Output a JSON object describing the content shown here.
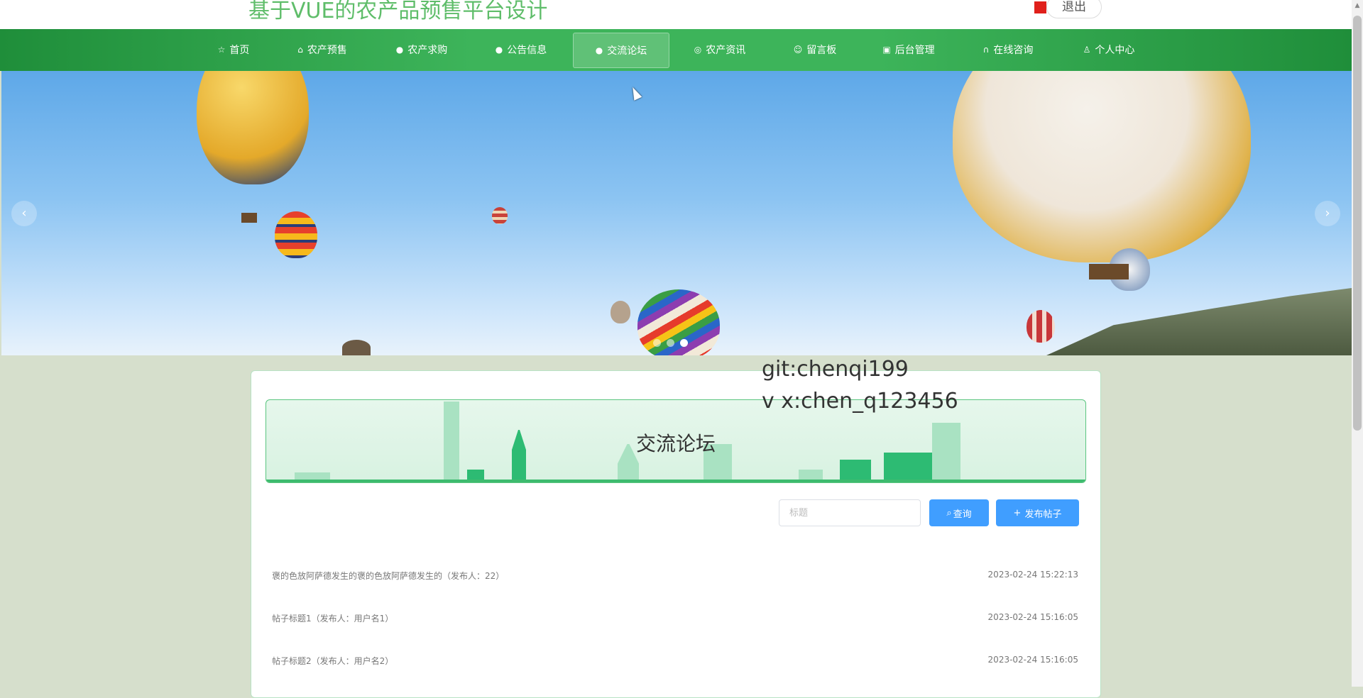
{
  "header": {
    "site_title": "基于VUE的农产品预售平台设计",
    "logout_label": "退出"
  },
  "nav": {
    "items": [
      {
        "label": "首页",
        "icon": "star-icon"
      },
      {
        "label": "农产预售",
        "icon": "bag-icon"
      },
      {
        "label": "农产求购",
        "icon": "info-icon"
      },
      {
        "label": "公告信息",
        "icon": "circle-icon"
      },
      {
        "label": "交流论坛",
        "icon": "info-icon",
        "active": true
      },
      {
        "label": "农产资讯",
        "icon": "globe-icon"
      },
      {
        "label": "留言板",
        "icon": "smile-icon"
      },
      {
        "label": "后台管理",
        "icon": "briefcase-icon"
      },
      {
        "label": "在线咨询",
        "icon": "headset-icon"
      },
      {
        "label": "个人中心",
        "icon": "user-icon"
      }
    ]
  },
  "carousel": {
    "prev": "‹",
    "next": "›",
    "dot_count": 3,
    "active_dot": 2
  },
  "watermark": {
    "line1": "git:chenqi199",
    "line2": "v x:chen_q123456"
  },
  "forum": {
    "title": "交流论坛",
    "search_placeholder": "标题",
    "search_button": "查询",
    "publish_button": "发布帖子",
    "posts": [
      {
        "title": "褒的色放阿萨德发生的褒的色放阿萨德发生的（发布人：22）",
        "date": "2023-02-24 15:22:13"
      },
      {
        "title": "帖子标题1（发布人：用户名1）",
        "date": "2023-02-24 15:16:05"
      },
      {
        "title": "帖子标题2（发布人：用户名2）",
        "date": "2023-02-24 15:16:05"
      }
    ]
  },
  "colors": {
    "nav_green": "#3db45a",
    "title_green": "#5fbd6a",
    "button_blue": "#409eff"
  }
}
